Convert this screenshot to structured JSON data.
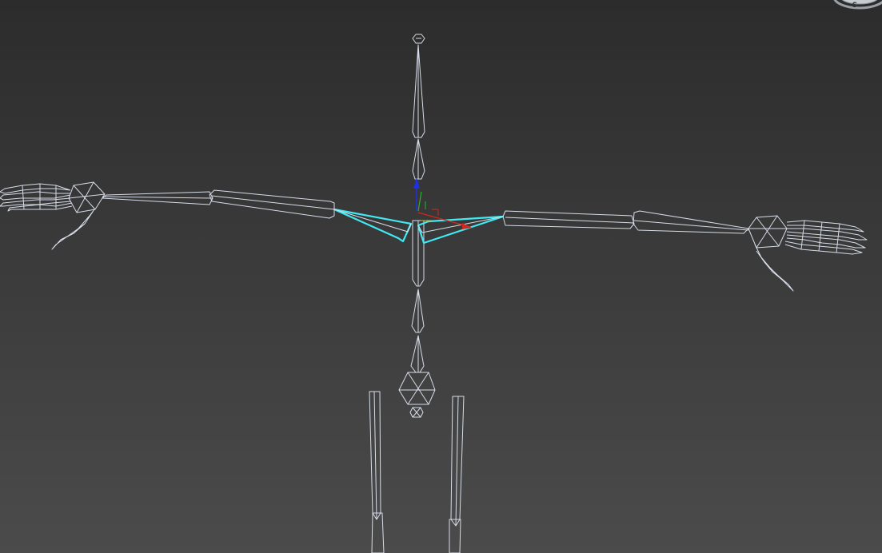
{
  "viewport": {
    "background_top": "#2c2c2c",
    "background_bottom": "#4b4b4b",
    "bone_color": "#d6dce8",
    "selected_bone_color": "#42e8f2"
  },
  "viewcube": {
    "compass_label": "S"
  },
  "gizmo": {
    "x_axis_color": "#d0281c",
    "y_axis_color": "#2bb32b",
    "z_axis_color": "#1e30e0"
  }
}
